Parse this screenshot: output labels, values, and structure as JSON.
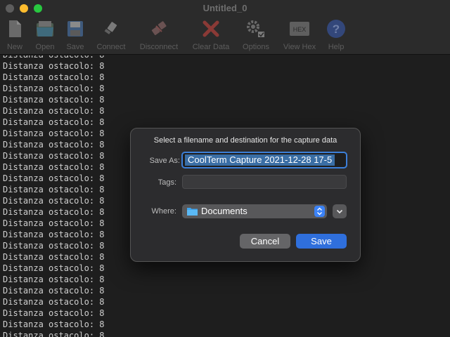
{
  "window": {
    "title": "Untitled_0"
  },
  "toolbar": {
    "items": [
      {
        "label": "New",
        "icon": "document-icon"
      },
      {
        "label": "Open",
        "icon": "folder-open-icon"
      },
      {
        "label": "Save",
        "icon": "floppy-disk-icon"
      },
      {
        "label": "Connect",
        "icon": "plug-connect-icon"
      },
      {
        "label": "Disconnect",
        "icon": "plug-disconnect-icon"
      },
      {
        "label": "Clear Data",
        "icon": "red-x-icon"
      },
      {
        "label": "Options",
        "icon": "gears-icon"
      },
      {
        "label": "View Hex",
        "icon": "hex-icon"
      },
      {
        "label": "Help",
        "icon": "help-icon"
      }
    ],
    "hex_icon_text": "HEX",
    "help_icon_text": "?"
  },
  "terminal": {
    "line_text": "Distanza ostacolo: 8"
  },
  "dialog": {
    "prompt": "Select a filename and destination for the capture data",
    "save_as_label": "Save As:",
    "save_as_value": "CoolTerm Capture 2021-12-28 17-5",
    "tags_label": "Tags:",
    "tags_value": "",
    "where_label": "Where:",
    "where_value": "Documents",
    "cancel_label": "Cancel",
    "save_label": "Save"
  },
  "colors": {
    "accent": "#3b82f6",
    "selection": "#3a6ea5",
    "dialog_bg": "#2c2c2e",
    "terminal_text": "#cfcfcf"
  }
}
